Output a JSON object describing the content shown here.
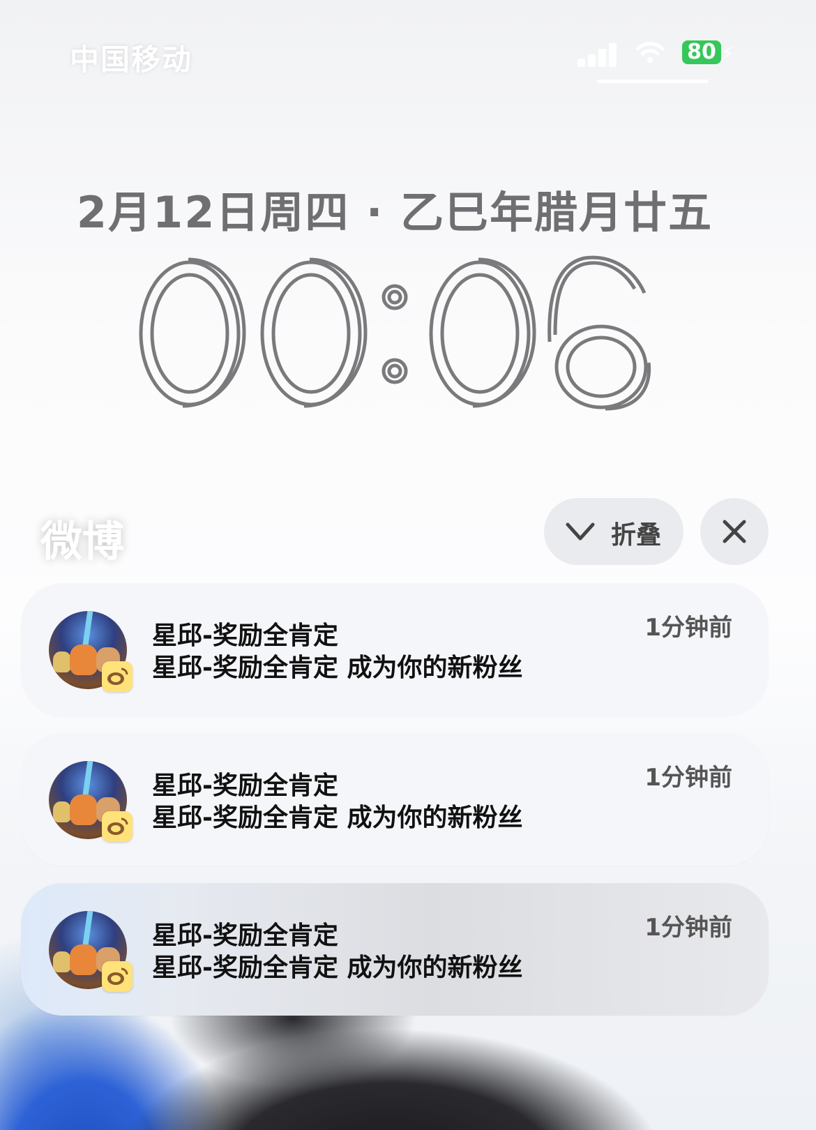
{
  "status_bar": {
    "carrier": "中国移动",
    "battery": "80",
    "battery_color": "#35c759",
    "icons": [
      "signal-icon",
      "wifi-icon",
      "battery-icon",
      "charging-bolt-icon"
    ]
  },
  "lock_screen": {
    "date": "2月12日周四 · 乙巳年腊月廿五",
    "time": "00:06"
  },
  "notification_group": {
    "app_name": "微博",
    "collapse_label": "折叠",
    "collapse_icon": "chevron-down-icon",
    "close_icon": "close-icon",
    "notifications": [
      {
        "title": "星邱-奖励全肯定",
        "body": "星邱-奖励全肯定 成为你的新粉丝",
        "time": "1分钟前"
      },
      {
        "title": "星邱-奖励全肯定",
        "body": "星邱-奖励全肯定 成为你的新粉丝",
        "time": "1分钟前"
      },
      {
        "title": "星邱-奖励全肯定",
        "body": "星邱-奖励全肯定 成为你的新粉丝",
        "time": "1分钟前"
      }
    ]
  }
}
